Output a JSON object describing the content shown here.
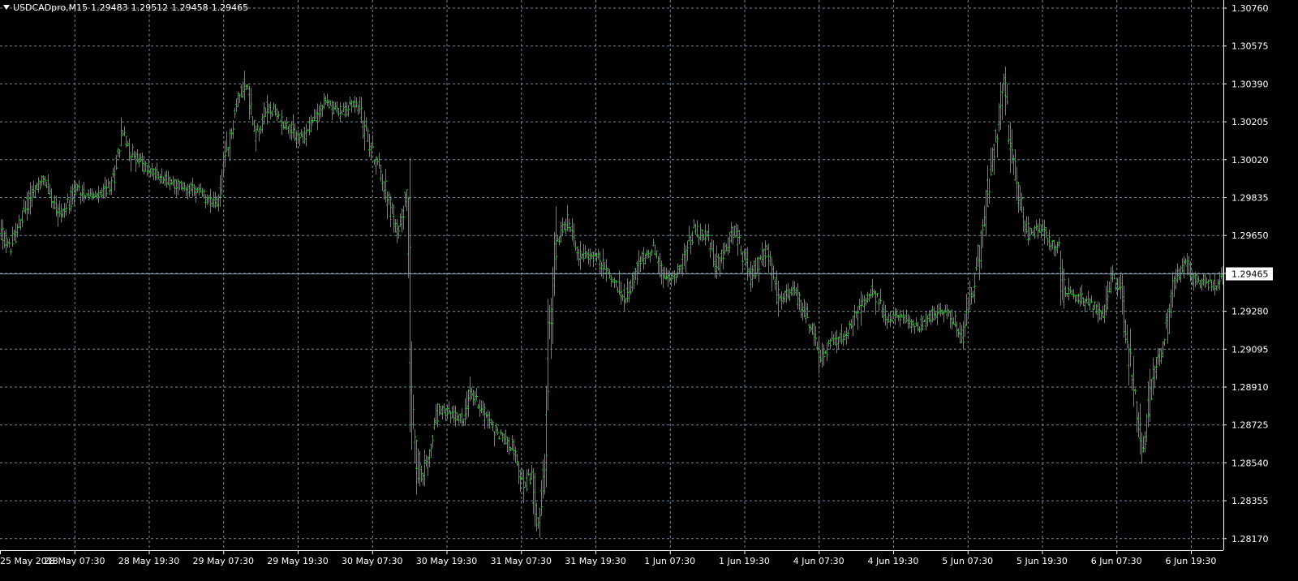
{
  "header": {
    "symbol": "USDCADpro,M15",
    "open": "1.29483",
    "high": "1.29512",
    "low": "1.29458",
    "close": "1.29465"
  },
  "colors": {
    "background": "#000000",
    "bars": "#00d000",
    "grid": "#7a8a99",
    "axis_text": "#ffffff",
    "bid_line": "#8aa0b4",
    "bid_label_bg": "#ffffff",
    "bid_label_text": "#000000"
  },
  "chart_data": {
    "type": "bar",
    "series": [
      {
        "name": "USDCADpro,M15",
        "style": "ohlc-bars"
      }
    ],
    "x_tick_labels": [
      "25 May 2018",
      "28 May 07:30",
      "28 May 19:30",
      "29 May 07:30",
      "29 May 19:30",
      "30 May 07:30",
      "30 May 19:30",
      "31 May 07:30",
      "31 May 19:30",
      "1 Jun 07:30",
      "1 Jun 19:30",
      "4 Jun 07:30",
      "4 Jun 19:30",
      "5 Jun 07:30",
      "5 Jun 19:30",
      "6 Jun 07:30",
      "6 Jun 19:30"
    ],
    "y_tick_labels": [
      "1.30760",
      "1.30575",
      "1.30390",
      "1.30205",
      "1.30020",
      "1.29835",
      "1.29650",
      "1.29465",
      "1.29280",
      "1.29095",
      "1.28910",
      "1.28725",
      "1.28540",
      "1.28355",
      "1.28170"
    ],
    "ylim": [
      1.2813,
      1.3078
    ],
    "current_price": 1.29465,
    "grid": true,
    "price_path": [
      [
        0,
        1.2968
      ],
      [
        12,
        1.2958
      ],
      [
        38,
        1.2985
      ],
      [
        55,
        1.2992
      ],
      [
        75,
        1.2975
      ],
      [
        95,
        1.2988
      ],
      [
        118,
        1.2983
      ],
      [
        138,
        1.299
      ],
      [
        150,
        1.3016
      ],
      [
        162,
        1.3005
      ],
      [
        180,
        1.2998
      ],
      [
        210,
        1.2991
      ],
      [
        240,
        1.2987
      ],
      [
        268,
        1.298
      ],
      [
        282,
        1.301
      ],
      [
        292,
        1.303
      ],
      [
        302,
        1.304
      ],
      [
        315,
        1.3015
      ],
      [
        330,
        1.3028
      ],
      [
        350,
        1.302
      ],
      [
        372,
        1.3012
      ],
      [
        400,
        1.303
      ],
      [
        420,
        1.3025
      ],
      [
        440,
        1.303
      ],
      [
        455,
        1.301
      ],
      [
        470,
        1.2995
      ],
      [
        490,
        1.2965
      ],
      [
        502,
        1.2988
      ],
      [
        507,
        1.2895
      ],
      [
        512,
        1.286
      ],
      [
        520,
        1.2845
      ],
      [
        530,
        1.286
      ],
      [
        540,
        1.288
      ],
      [
        555,
        1.2878
      ],
      [
        570,
        1.2875
      ],
      [
        580,
        1.2888
      ],
      [
        595,
        1.288
      ],
      [
        610,
        1.287
      ],
      [
        630,
        1.2863
      ],
      [
        645,
        1.2842
      ],
      [
        655,
        1.2848
      ],
      [
        662,
        1.2825
      ],
      [
        672,
        1.2855
      ],
      [
        678,
        1.292
      ],
      [
        685,
        1.296
      ],
      [
        700,
        1.2972
      ],
      [
        715,
        1.2955
      ],
      [
        735,
        1.2955
      ],
      [
        752,
        1.2945
      ],
      [
        770,
        1.2935
      ],
      [
        790,
        1.2952
      ],
      [
        805,
        1.296
      ],
      [
        820,
        1.2942
      ],
      [
        840,
        1.295
      ],
      [
        856,
        1.2968
      ],
      [
        870,
        1.2965
      ],
      [
        885,
        1.295
      ],
      [
        905,
        1.2968
      ],
      [
        925,
        1.2945
      ],
      [
        945,
        1.2958
      ],
      [
        960,
        1.2935
      ],
      [
        980,
        1.2937
      ],
      [
        1000,
        1.292
      ],
      [
        1010,
        1.2905
      ],
      [
        1025,
        1.2912
      ],
      [
        1045,
        1.2918
      ],
      [
        1060,
        1.293
      ],
      [
        1075,
        1.2938
      ],
      [
        1090,
        1.2925
      ],
      [
        1110,
        1.2925
      ],
      [
        1130,
        1.292
      ],
      [
        1150,
        1.2927
      ],
      [
        1170,
        1.2928
      ],
      [
        1185,
        1.2915
      ],
      [
        1200,
        1.294
      ],
      [
        1210,
        1.2965
      ],
      [
        1220,
        1.2995
      ],
      [
        1230,
        1.302
      ],
      [
        1236,
        1.3045
      ],
      [
        1245,
        1.301
      ],
      [
        1255,
        1.2985
      ],
      [
        1268,
        1.2965
      ],
      [
        1280,
        1.297
      ],
      [
        1295,
        1.2962
      ],
      [
        1305,
        1.296
      ],
      [
        1310,
        1.2938
      ],
      [
        1325,
        1.2935
      ],
      [
        1345,
        1.2932
      ],
      [
        1360,
        1.2925
      ],
      [
        1372,
        1.2945
      ],
      [
        1382,
        1.2938
      ],
      [
        1392,
        1.2905
      ],
      [
        1400,
        1.2885
      ],
      [
        1406,
        1.286
      ],
      [
        1412,
        1.2868
      ],
      [
        1420,
        1.2895
      ],
      [
        1435,
        1.2912
      ],
      [
        1445,
        1.294
      ],
      [
        1460,
        1.2952
      ],
      [
        1470,
        1.2945
      ],
      [
        1485,
        1.2942
      ],
      [
        1500,
        1.294
      ],
      [
        1508,
        1.2946
      ]
    ]
  }
}
